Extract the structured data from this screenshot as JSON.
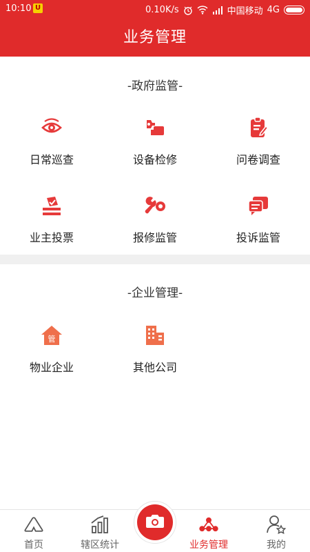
{
  "status_bar": {
    "time": "10:10",
    "badge": "U",
    "speed": "0.10K/s",
    "carrier": "中国移动",
    "network": "4G"
  },
  "header": {
    "title": "业务管理"
  },
  "gov_section": {
    "title": "-政府监管-",
    "items": [
      {
        "label": "日常巡查",
        "icon": "eye-icon"
      },
      {
        "label": "设备检修",
        "icon": "wrench-hand-icon"
      },
      {
        "label": "问卷调查",
        "icon": "clipboard-edit-icon"
      },
      {
        "label": "业主投票",
        "icon": "ballot-box-icon"
      },
      {
        "label": "报修监管",
        "icon": "wrench-gear-icon"
      },
      {
        "label": "投诉监管",
        "icon": "chat-lines-icon"
      }
    ]
  },
  "ent_section": {
    "title": "-企业管理-",
    "items": [
      {
        "label": "物业企业",
        "icon": "house-manage-icon",
        "icon_text": "管"
      },
      {
        "label": "其他公司",
        "icon": "building-icon"
      }
    ]
  },
  "tabbar": {
    "tabs": [
      {
        "label": "首页",
        "icon": "home-icon"
      },
      {
        "label": "辖区统计",
        "icon": "bar-chart-icon"
      },
      {
        "label": "业务管理",
        "icon": "network-icon",
        "active": true
      },
      {
        "label": "我的",
        "icon": "user-star-icon"
      }
    ],
    "camera_icon": "camera-icon"
  },
  "colors": {
    "primary": "#e02b2b",
    "icon_red": "#e63a3a",
    "icon_orange": "#ef6f4b",
    "gap_gray": "#f0f0f0"
  }
}
